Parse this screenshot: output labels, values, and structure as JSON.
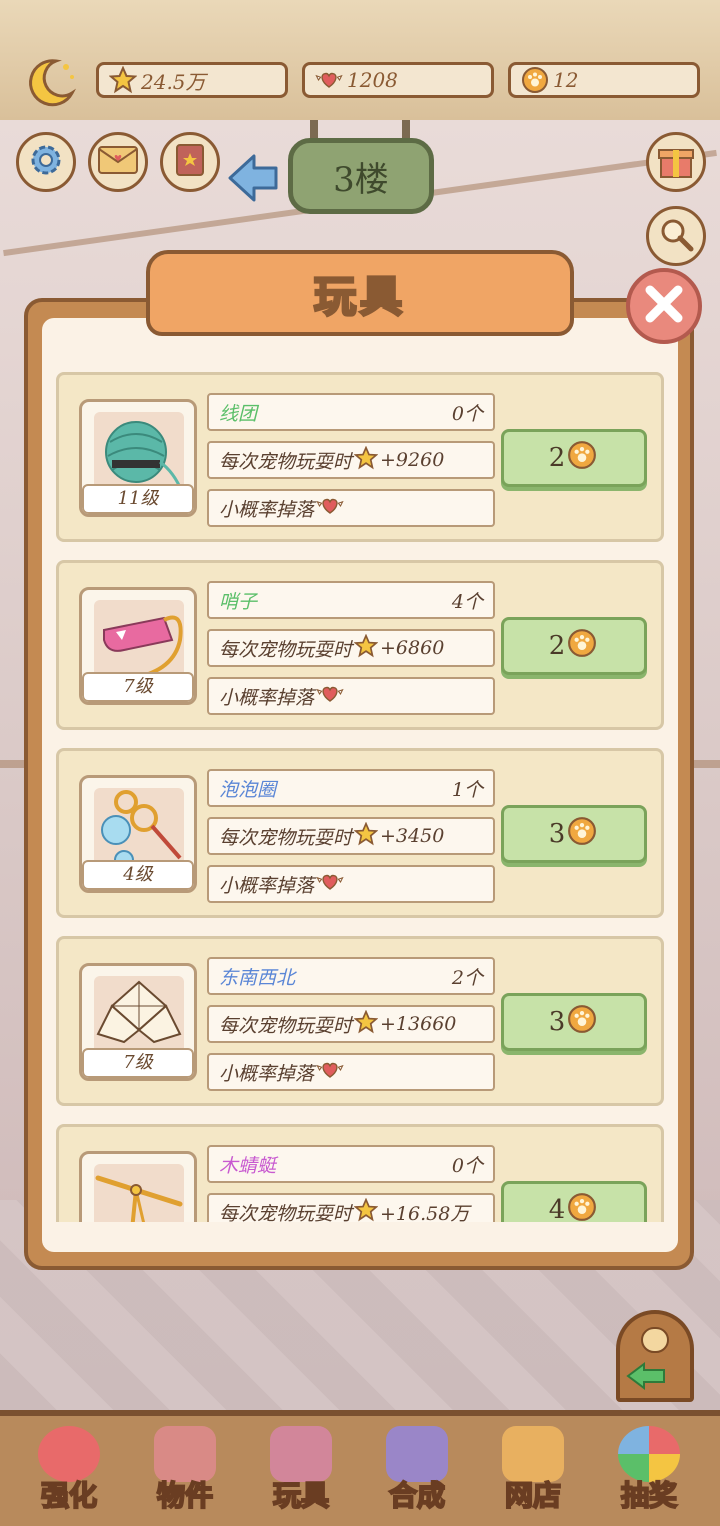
{
  "resources": {
    "stars": "24.5万",
    "hearts": "1208",
    "coins": "12"
  },
  "floor_label": "3楼",
  "panel": {
    "title": "玩具"
  },
  "toys": [
    {
      "name": "线团",
      "name_color": "#5bbf69",
      "count": "0个",
      "level": "11级",
      "effect_prefix": "每次宠物玩耍时",
      "effect_value": "+9260",
      "drop": "小概率掉落",
      "price": "2",
      "art": "yarn-ball"
    },
    {
      "name": "哨子",
      "name_color": "#5bbf69",
      "count": "4个",
      "level": "7级",
      "effect_prefix": "每次宠物玩耍时",
      "effect_value": "+6860",
      "drop": "小概率掉落",
      "price": "2",
      "art": "whistle"
    },
    {
      "name": "泡泡圈",
      "name_color": "#5a86d6",
      "count": "1个",
      "level": "4级",
      "effect_prefix": "每次宠物玩耍时",
      "effect_value": "+3450",
      "drop": "小概率掉落",
      "price": "3",
      "art": "bubble-wand"
    },
    {
      "name": "东南西北",
      "name_color": "#5a86d6",
      "count": "2个",
      "level": "7级",
      "effect_prefix": "每次宠物玩耍时",
      "effect_value": "+13660",
      "drop": "小概率掉落",
      "price": "3",
      "art": "fortune-teller"
    },
    {
      "name": "木蜻蜓",
      "name_color": "#c85ad0",
      "count": "0个",
      "level": "",
      "effect_prefix": "每次宠物玩耍时",
      "effect_value": "+16.58万",
      "drop": "",
      "price": "4",
      "art": "bamboo-copter"
    }
  ],
  "nav": [
    {
      "label": "强化",
      "icon": "lollipop-icon"
    },
    {
      "label": "物件",
      "icon": "piano-icon"
    },
    {
      "label": "玩具",
      "icon": "toy-box-icon"
    },
    {
      "label": "合成",
      "icon": "cards-icon"
    },
    {
      "label": "网店",
      "icon": "basket-icon"
    },
    {
      "label": "抽奖",
      "icon": "wheel-icon"
    }
  ],
  "colors": {
    "accent": "#f0a565",
    "border": "#8a5a33",
    "buy_button": "#c7e2a8",
    "card": "#f4e7c6"
  }
}
